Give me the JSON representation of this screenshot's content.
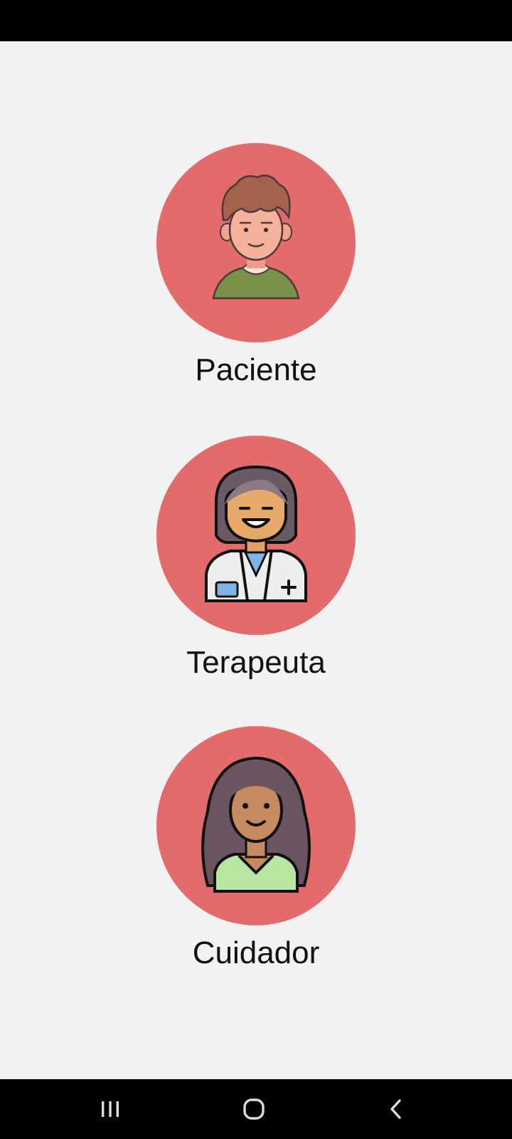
{
  "roles": [
    {
      "label": "Paciente",
      "icon": "patient-avatar-icon"
    },
    {
      "label": "Terapeuta",
      "icon": "therapist-avatar-icon"
    },
    {
      "label": "Cuidador",
      "icon": "caregiver-avatar-icon"
    }
  ],
  "colors": {
    "background": "#f2f2f2",
    "circle": "#e46b6b",
    "label_text": "#111111",
    "system_bars": "#000000"
  },
  "nav": {
    "recents_icon": "recents-icon",
    "home_icon": "home-icon",
    "back_icon": "back-icon"
  }
}
